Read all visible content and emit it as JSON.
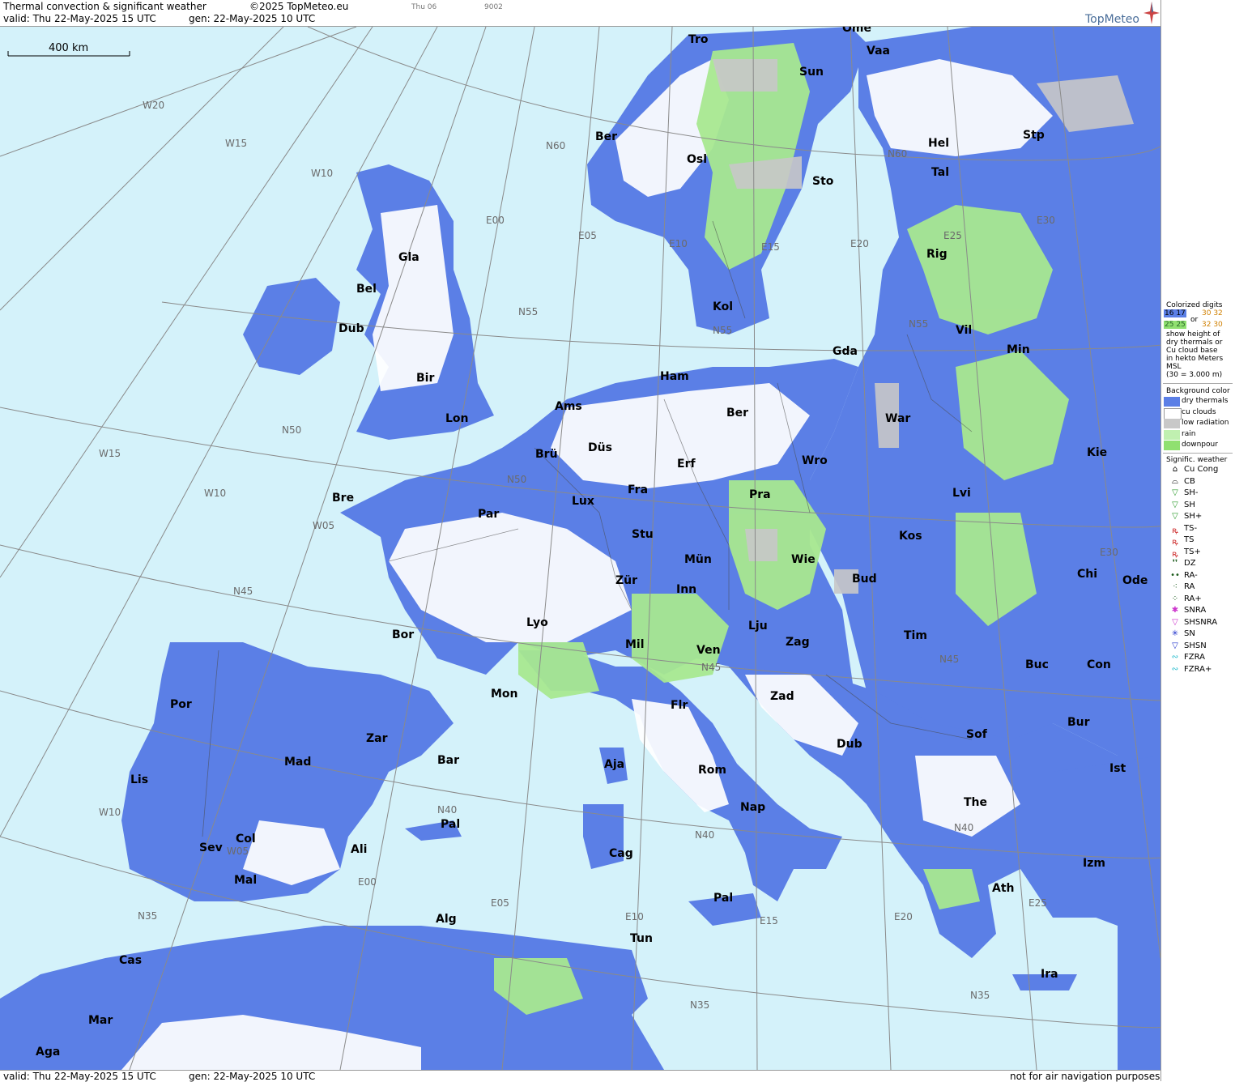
{
  "header": {
    "title": "Thermal convection & significant weather",
    "copyright": "©2025 TopMeteo.eu",
    "mini_label_1": "Thu 06",
    "mini_label_2": "9002",
    "valid": "valid:  Thu   22-May-2025  15 UTC",
    "gen": "gen:  22-May-2025 10 UTC",
    "logo": "TopMeteo"
  },
  "footer": {
    "valid": "valid:  Thu   22-May-2025  15 UTC",
    "gen": "gen:  22-May-2025 10 UTC",
    "disclaimer": "not for air navigation purposes"
  },
  "map": {
    "scale_label": "400 km",
    "cities": [
      "Tro",
      "Ome",
      "Vaa",
      "Sun",
      "Ber",
      "Osl",
      "Sto",
      "Hel",
      "Stp",
      "Tal",
      "Gla",
      "Bel",
      "Rig",
      "Dub",
      "Kol",
      "Vil",
      "Min",
      "Gda",
      "Ham",
      "Bir",
      "Lon",
      "Ams",
      "Ber",
      "War",
      "Brü",
      "Düs",
      "Erf",
      "Wro",
      "Kie",
      "Fra",
      "Lux",
      "Pra",
      "Lvi",
      "Bre",
      "Par",
      "Stu",
      "Kos",
      "Mün",
      "Wie",
      "Chi",
      "Ode",
      "Bud",
      "Zür",
      "Inn",
      "Lyo",
      "Lju",
      "Tim",
      "Bor",
      "Mil",
      "Ven",
      "Zag",
      "Buc",
      "Con",
      "Mon",
      "Flr",
      "Zad",
      "Por",
      "Bur",
      "Bar",
      "Zar",
      "Sof",
      "Dub",
      "Aja",
      "Rom",
      "Mad",
      "Ist",
      "Lis",
      "The",
      "Nap",
      "Pal",
      "Col",
      "Ali",
      "Sev",
      "Cag",
      "Izm",
      "Mal",
      "Ath",
      "Pal",
      "Alg",
      "Tun",
      "Cas",
      "Ira",
      "Mar",
      "Aga"
    ],
    "grid_labels": [
      "W20",
      "W15",
      "W10",
      "E00",
      "E05",
      "E10",
      "E15",
      "E20",
      "E25",
      "E30",
      "N60",
      "N55",
      "N50",
      "N45",
      "N40",
      "N35",
      "W15",
      "W10",
      "W05",
      "E00",
      "E05",
      "E10",
      "E15",
      "E20",
      "E25",
      "N55",
      "N50",
      "N45",
      "N40",
      "N35",
      "W10",
      "W05",
      "N35",
      "N40",
      "N45",
      "N55",
      "N60",
      "E30"
    ]
  },
  "legend": {
    "digits_title": "Colorized digits",
    "digits_sample_a": "16 17",
    "digits_or": "or",
    "digits_sample_b": "30 32",
    "digits_sample_c": "25 25",
    "digits_sample_d": "32 30",
    "digits_desc": [
      "show height of",
      "dry thermals or",
      "Cu cloud base",
      "in hekto Meters",
      "MSL",
      "(30 = 3.000 m)"
    ],
    "bg_title": "Background color",
    "bg_items": [
      {
        "label": "dry thermals",
        "color": "#5b7fe6"
      },
      {
        "label": "cu clouds",
        "color": "#ffffff"
      },
      {
        "label": "low radiation",
        "color": "#c8c8c8"
      },
      {
        "label": "rain",
        "color": "#c0f0b0"
      },
      {
        "label": "downpour",
        "color": "#90e070"
      }
    ],
    "sig_title": "Signific. weather",
    "sig_items": [
      {
        "label": "Cu Cong",
        "glyph": "⌂",
        "color": "#000000"
      },
      {
        "label": "CB",
        "glyph": "⌓",
        "color": "#000000"
      },
      {
        "label": "SH-",
        "glyph": "▽",
        "color": "#2a9a2a"
      },
      {
        "label": "SH",
        "glyph": "▽",
        "color": "#2a9a2a"
      },
      {
        "label": "SH+",
        "glyph": "▽",
        "color": "#2a9a2a"
      },
      {
        "label": "TS-",
        "glyph": "ꝶ",
        "color": "#cc2222"
      },
      {
        "label": "TS",
        "glyph": "ꝶ",
        "color": "#cc2222"
      },
      {
        "label": "TS+",
        "glyph": "ꝶ",
        "color": "#cc2222"
      },
      {
        "label": "DZ",
        "glyph": "❜❜",
        "color": "#1a5a1a"
      },
      {
        "label": "RA-",
        "glyph": "••",
        "color": "#1a5a1a"
      },
      {
        "label": "RA",
        "glyph": "⁖",
        "color": "#1a5a1a"
      },
      {
        "label": "RA+",
        "glyph": "⁘",
        "color": "#1a5a1a"
      },
      {
        "label": "SNRA",
        "glyph": "✱",
        "color": "#cc33cc"
      },
      {
        "label": "SHSNRA",
        "glyph": "▽",
        "color": "#cc33cc"
      },
      {
        "label": "SN",
        "glyph": "✳",
        "color": "#2233cc"
      },
      {
        "label": "SHSN",
        "glyph": "▽",
        "color": "#2233cc"
      },
      {
        "label": "FZRA",
        "glyph": "∾",
        "color": "#22bbcc"
      },
      {
        "label": "FZRA+",
        "glyph": "∾",
        "color": "#22bbcc"
      }
    ]
  }
}
